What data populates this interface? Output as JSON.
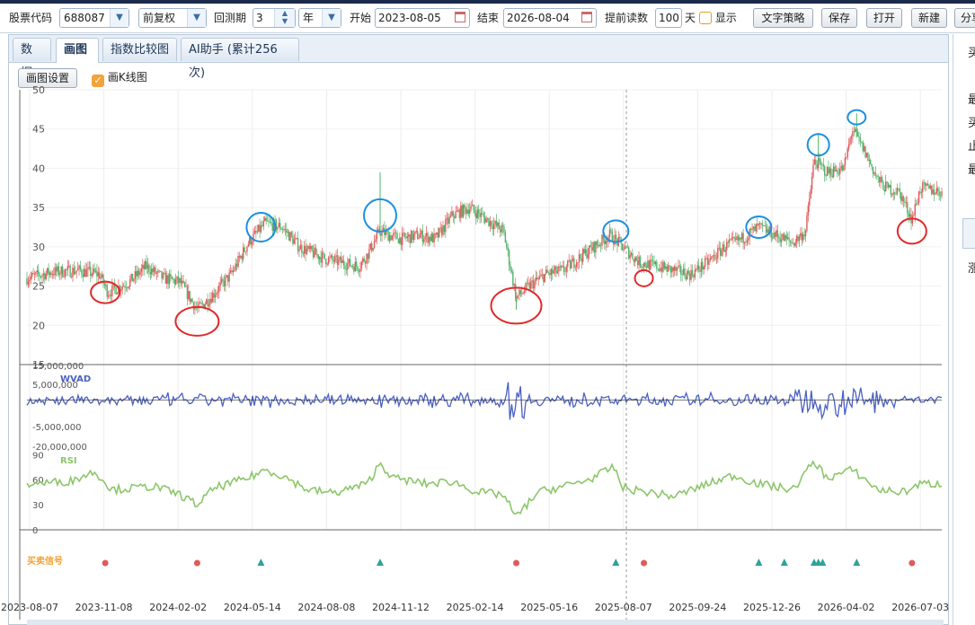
{
  "toolbar": {
    "code_label": "股票代码",
    "code_value": "688087",
    "adjust_value": "前复权",
    "period_label": "回测期",
    "period_value": "3",
    "period_unit": "年",
    "start_label": "开始",
    "start_value": "2023-08-05",
    "end_label": "结束",
    "end_value": "2026-08-04",
    "lookahead_label": "提前读数",
    "lookahead_value": "100",
    "lookahead_unit": "天",
    "show_label": "显示",
    "show_checked": false,
    "text_strategy_btn": "文字策略",
    "save_btn": "保存",
    "open_btn": "打开",
    "new_btn": "新建",
    "share_btn": "分享"
  },
  "tabs": [
    {
      "label": "数据",
      "active": false
    },
    {
      "label": "画图",
      "active": true
    },
    {
      "label": "指数比较图",
      "active": false
    },
    {
      "label": "AI助手 (累计256次)",
      "active": false
    }
  ],
  "chart_toolbar": {
    "settings_btn": "画图设置",
    "kline_label": "画K线图",
    "kline_checked": true
  },
  "right_panel_fragments": [
    "买",
    "最",
    "买",
    "止",
    "最",
    "涨"
  ],
  "colors": {
    "up_candle": "#e05a5a",
    "down_candle": "#52b36a",
    "wvad_line": "#4a60c2",
    "rsi_line": "#8cc66a",
    "buy_marker": "#e05a5a",
    "sell_marker": "#2ea39a",
    "low_circle": "#e02a2a",
    "high_circle": "#1a8fe0",
    "signal_label": "#f2a33a",
    "accent": "#1a8fe0"
  },
  "chart_data": [
    {
      "type": "candlestick",
      "ylim": [
        15,
        50
      ],
      "yticks": [
        50,
        45,
        40,
        35,
        30,
        25,
        20,
        15
      ],
      "x_ticks": [
        "2023-08-07",
        "2023-11-08",
        "2024-02-02",
        "2024-05-14",
        "2024-08-08",
        "2024-11-12",
        "2025-02-14",
        "2025-05-16",
        "2025-08-07",
        "2025-09-24",
        "2025-12-26",
        "2026-04-02",
        "2026-07-03"
      ],
      "price_path": [
        [
          0,
          26
        ],
        [
          0.03,
          26.8
        ],
        [
          0.06,
          27
        ],
        [
          0.085,
          26.5
        ],
        [
          0.095,
          24.2
        ],
        [
          0.12,
          25.5
        ],
        [
          0.14,
          27.5
        ],
        [
          0.16,
          26
        ],
        [
          0.18,
          25.5
        ],
        [
          0.2,
          22
        ],
        [
          0.215,
          23.5
        ],
        [
          0.24,
          26.5
        ],
        [
          0.26,
          30.5
        ],
        [
          0.28,
          33
        ],
        [
          0.3,
          32.5
        ],
        [
          0.32,
          30
        ],
        [
          0.35,
          28.5
        ],
        [
          0.37,
          28
        ],
        [
          0.39,
          27.5
        ],
        [
          0.4,
          29
        ],
        [
          0.415,
          32
        ],
        [
          0.425,
          31.5
        ],
        [
          0.44,
          31
        ],
        [
          0.46,
          31.5
        ],
        [
          0.48,
          31
        ],
        [
          0.5,
          34
        ],
        [
          0.52,
          35
        ],
        [
          0.54,
          33.5
        ],
        [
          0.56,
          32
        ],
        [
          0.575,
          23.5
        ],
        [
          0.59,
          25
        ],
        [
          0.61,
          26.5
        ],
        [
          0.63,
          27
        ],
        [
          0.66,
          29.5
        ],
        [
          0.685,
          31.5
        ],
        [
          0.7,
          30
        ],
        [
          0.72,
          28
        ],
        [
          0.74,
          27.5
        ],
        [
          0.76,
          27
        ],
        [
          0.78,
          26.5
        ],
        [
          0.8,
          28
        ],
        [
          0.82,
          30
        ],
        [
          0.84,
          31
        ],
        [
          0.86,
          32.5
        ],
        [
          0.88,
          31.5
        ],
        [
          0.9,
          30.5
        ],
        [
          0.915,
          32
        ],
        [
          0.925,
          41
        ],
        [
          0.94,
          39.5
        ],
        [
          0.96,
          40
        ],
        [
          0.97,
          45
        ],
        [
          0.985,
          42
        ],
        [
          1.0,
          38.5
        ],
        [
          1.01,
          37.5
        ],
        [
          1.025,
          37
        ],
        [
          1.04,
          33.5
        ],
        [
          1.05,
          37.5
        ],
        [
          1.075,
          37
        ]
      ],
      "low_circles": [
        {
          "x": 0.092,
          "y": 24.2,
          "w": 16,
          "h": 12
        },
        {
          "x": 0.2,
          "y": 20.5,
          "w": 24,
          "h": 16
        },
        {
          "x": 0.575,
          "y": 22.5,
          "w": 28,
          "h": 20
        },
        {
          "x": 0.725,
          "y": 26.0,
          "w": 10,
          "h": 9
        },
        {
          "x": 1.04,
          "y": 32.0,
          "w": 16,
          "h": 14
        }
      ],
      "high_circles": [
        {
          "x": 0.275,
          "y": 32.5,
          "w": 16,
          "h": 16
        },
        {
          "x": 0.415,
          "y": 34.0,
          "w": 18,
          "h": 18
        },
        {
          "x": 0.692,
          "y": 32.0,
          "w": 14,
          "h": 12
        },
        {
          "x": 0.86,
          "y": 32.5,
          "w": 14,
          "h": 12
        },
        {
          "x": 0.93,
          "y": 43.0,
          "w": 12,
          "h": 12
        },
        {
          "x": 0.975,
          "y": 46.5,
          "w": 10,
          "h": 8
        }
      ]
    },
    {
      "type": "line",
      "series": [
        {
          "name": "WVAD"
        }
      ],
      "yticks": [
        "15,000,000",
        "5,000,000",
        "-5,000,000",
        "-20,000,000"
      ],
      "ylim": [
        -20000000,
        15000000
      ]
    },
    {
      "type": "line",
      "series": [
        {
          "name": "RSI"
        }
      ],
      "yticks": [
        90,
        60,
        30,
        0
      ],
      "ylim": [
        0,
        100
      ],
      "path": [
        [
          0,
          55
        ],
        [
          0.05,
          58
        ],
        [
          0.08,
          70
        ],
        [
          0.1,
          48
        ],
        [
          0.15,
          52
        ],
        [
          0.18,
          42
        ],
        [
          0.2,
          30
        ],
        [
          0.22,
          50
        ],
        [
          0.26,
          62
        ],
        [
          0.28,
          72
        ],
        [
          0.3,
          65
        ],
        [
          0.33,
          48
        ],
        [
          0.36,
          44
        ],
        [
          0.4,
          55
        ],
        [
          0.415,
          80
        ],
        [
          0.43,
          62
        ],
        [
          0.47,
          55
        ],
        [
          0.5,
          58
        ],
        [
          0.53,
          45
        ],
        [
          0.56,
          42
        ],
        [
          0.575,
          15
        ],
        [
          0.6,
          45
        ],
        [
          0.63,
          52
        ],
        [
          0.66,
          60
        ],
        [
          0.69,
          75
        ],
        [
          0.7,
          50
        ],
        [
          0.73,
          45
        ],
        [
          0.76,
          40
        ],
        [
          0.8,
          55
        ],
        [
          0.83,
          65
        ],
        [
          0.86,
          55
        ],
        [
          0.9,
          48
        ],
        [
          0.925,
          82
        ],
        [
          0.94,
          62
        ],
        [
          0.97,
          72
        ],
        [
          1.0,
          48
        ],
        [
          1.03,
          45
        ],
        [
          1.05,
          55
        ],
        [
          1.075,
          55
        ]
      ]
    },
    {
      "type": "scatter",
      "label": "买卖信号",
      "buy_points_x": [
        0.092,
        0.2,
        0.575,
        0.725,
        1.04
      ],
      "sell_points_x": [
        0.275,
        0.415,
        0.692,
        0.86,
        0.89,
        0.925,
        0.93,
        0.935,
        0.975
      ]
    }
  ]
}
